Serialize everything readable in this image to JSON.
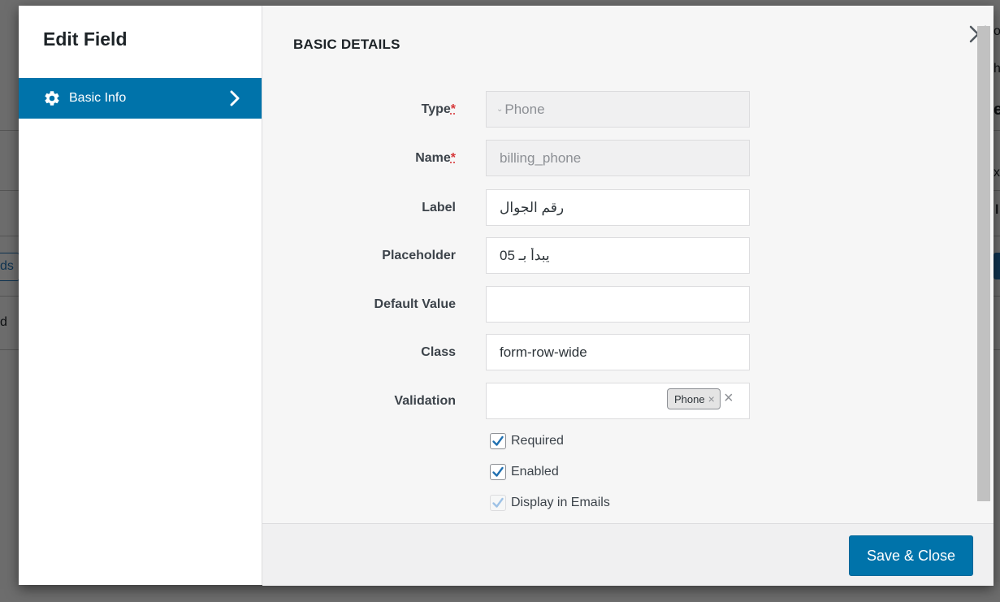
{
  "modal": {
    "title": "Edit Field",
    "sidebar": {
      "items": [
        {
          "label": "Basic Info",
          "icon": "gear-icon",
          "active": true
        }
      ]
    },
    "section_title": "BASIC DETAILS",
    "required_marker": "*",
    "fields": {
      "type": {
        "label": "Type",
        "value": "Phone"
      },
      "name": {
        "label": "Name",
        "value": "billing_phone"
      },
      "label": {
        "label": "Label",
        "value": "رقم الجوال"
      },
      "placeholder": {
        "label": "Placeholder",
        "value": "يبدأ بـ 05"
      },
      "default_value": {
        "label": "Default Value",
        "value": ""
      },
      "class": {
        "label": "Class",
        "value": "form-row-wide"
      },
      "validation": {
        "label": "Validation",
        "tags": [
          "Phone"
        ]
      }
    },
    "checkboxes": {
      "required": {
        "label": "Required",
        "checked": true
      },
      "enabled": {
        "label": "Enabled",
        "checked": true
      },
      "display_in_emails": {
        "label": "Display in Emails",
        "checked": true,
        "disabled": true
      }
    },
    "save_button": "Save & Close"
  },
  "background": {
    "fragment_left_1": "ds",
    "fragment_left_2": "d",
    "fragment_right_1": "o",
    "fragment_right_2": "h",
    "fragment_right_3": "e",
    "fragment_right_4": "x",
    "fragment_right_5": "l",
    "fragment_right_6": "A"
  },
  "colors": {
    "accent": "#0073aa",
    "required": "#d63638",
    "check": "#2271b1"
  }
}
